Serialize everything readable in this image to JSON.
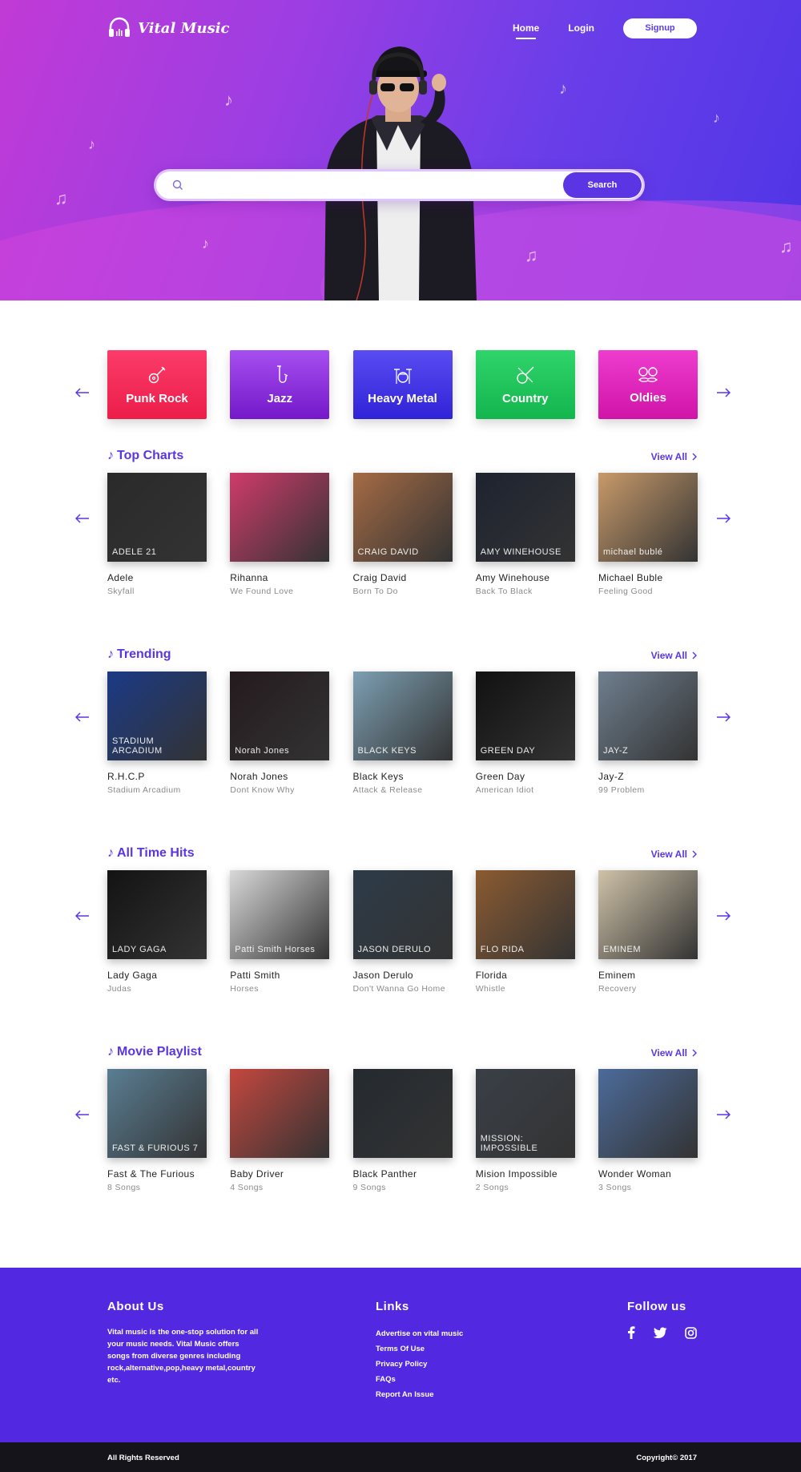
{
  "brand": {
    "name": "Vital Music"
  },
  "nav": {
    "home": "Home",
    "login": "Login",
    "signup": "Signup"
  },
  "search": {
    "placeholder": "",
    "button": "Search"
  },
  "colors": {
    "primary": "#5a35e3",
    "footer": "#5229e0",
    "bottom_bar": "#15141b"
  },
  "genres": [
    {
      "label": "Punk Rock",
      "icon": "guitar-icon",
      "color": "#f2305b"
    },
    {
      "label": "Jazz",
      "icon": "saxophone-icon",
      "color": "#8a2be2"
    },
    {
      "label": "Heavy Metal",
      "icon": "drum-kit-icon",
      "color": "#4a3be6"
    },
    {
      "label": "Country",
      "icon": "banjo-icon",
      "color": "#1fc15a"
    },
    {
      "label": "Oldies",
      "icon": "mustache-glasses-icon",
      "color": "#e42ac0"
    }
  ],
  "view_all": "View All",
  "sections": [
    {
      "title": "Top Charts",
      "items": [
        {
          "title": "Adele",
          "sub": "Skyfall",
          "cover_text": "ADELE 21",
          "cover_color": "#2a2a2a"
        },
        {
          "title": "Rihanna",
          "sub": "We Found Love",
          "cover_text": "",
          "cover_color": "#d03b6c"
        },
        {
          "title": "Craig David",
          "sub": "Born To Do",
          "cover_text": "CRAIG DAVID",
          "cover_color": "#a56b45"
        },
        {
          "title": "Amy Winehouse",
          "sub": "Back To Black",
          "cover_text": "AMY WINEHOUSE",
          "cover_color": "#1d2330"
        },
        {
          "title": "Michael Buble",
          "sub": "Feeling Good",
          "cover_text": "michael bublé",
          "cover_color": "#c89a6a"
        }
      ]
    },
    {
      "title": "Trending",
      "items": [
        {
          "title": "R.H.C.P",
          "sub": "Stadium Arcadium",
          "cover_text": "STADIUM ARCADIUM",
          "cover_color": "#1b3a86"
        },
        {
          "title": "Norah Jones",
          "sub": "Dont Know Why",
          "cover_text": "Norah Jones",
          "cover_color": "#241a1d"
        },
        {
          "title": "Black Keys",
          "sub": "Attack & Release",
          "cover_text": "BLACK KEYS",
          "cover_color": "#7d9fb3"
        },
        {
          "title": "Green Day",
          "sub": "American Idiot",
          "cover_text": "GREEN DAY",
          "cover_color": "#111111"
        },
        {
          "title": "Jay-Z",
          "sub": "99 Problem",
          "cover_text": "JAY-Z",
          "cover_color": "#6f7f8f"
        }
      ]
    },
    {
      "title": "All Time Hits",
      "items": [
        {
          "title": "Lady Gaga",
          "sub": "Judas",
          "cover_text": "LADY GAGA",
          "cover_color": "#131313"
        },
        {
          "title": "Patti Smith",
          "sub": "Horses",
          "cover_text": "Patti Smith Horses",
          "cover_color": "#d9d9d9"
        },
        {
          "title": "Jason Derulo",
          "sub": "Don't Wanna Go Home",
          "cover_text": "JASON DERULO",
          "cover_color": "#2d3b48"
        },
        {
          "title": "Florida",
          "sub": "Whistle",
          "cover_text": "FLO RIDA",
          "cover_color": "#8b5b31"
        },
        {
          "title": "Eminem",
          "sub": "Recovery",
          "cover_text": "EMINEM",
          "cover_color": "#cfc2a8"
        }
      ]
    },
    {
      "title": "Movie Playlist",
      "items": [
        {
          "title": "Fast & The Furious",
          "sub": "8 Songs",
          "cover_text": "FAST & FURIOUS 7",
          "cover_color": "#5a7e93"
        },
        {
          "title": "Baby Driver",
          "sub": "4 Songs",
          "cover_text": "",
          "cover_color": "#c4473f"
        },
        {
          "title": "Black Panther",
          "sub": "9 Songs",
          "cover_text": "",
          "cover_color": "#242a30"
        },
        {
          "title": "Mision Impossible",
          "sub": "2 Songs",
          "cover_text": "MISSION: IMPOSSIBLE",
          "cover_color": "#3a3f47"
        },
        {
          "title": "Wonder Woman",
          "sub": "3 Songs",
          "cover_text": "",
          "cover_color": "#4c6b9a"
        }
      ]
    }
  ],
  "footer": {
    "about_title": "About Us",
    "about_text": "Vital music is the one-stop solution for all your music needs. Vital Music offers songs from diverse genres including rock,alternative,pop,heavy metal,country etc.",
    "links_title": "Links",
    "links": [
      "Advertise on vital music",
      "Terms Of Use",
      "Privacy Policy",
      "FAQs",
      "Report An Issue"
    ],
    "follow_title": "Follow us",
    "social": [
      "facebook-icon",
      "twitter-icon",
      "instagram-icon"
    ],
    "rights": "All Rights Reserved",
    "copyright": "Copyright© 2017"
  }
}
